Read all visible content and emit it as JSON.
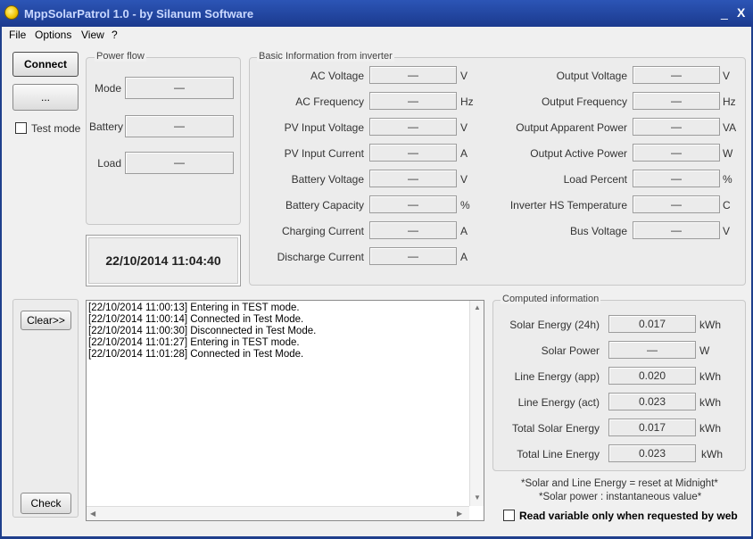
{
  "window": {
    "title": "MppSolarPatrol 1.0 - by Silanum Software",
    "minimize_glyph": "_",
    "close_glyph": "X",
    "app_icon": "sun-icon"
  },
  "menu": [
    {
      "label": "File"
    },
    {
      "label": "Options"
    },
    {
      "label": "View"
    },
    {
      "label": "?"
    }
  ],
  "left": {
    "connect_label": "Connect",
    "port_label": "...",
    "test_mode_label": "Test mode"
  },
  "power_flow": {
    "title": "Power flow",
    "rows": [
      {
        "label": "Mode",
        "value": "—"
      },
      {
        "label": "Battery",
        "value": "—"
      },
      {
        "label": "Load",
        "value": "—"
      }
    ]
  },
  "clock": "22/10/2014 11:04:40",
  "basic_info": {
    "title": "Basic Information from inverter",
    "left": [
      {
        "label": "AC Voltage",
        "value": "—",
        "unit": "V"
      },
      {
        "label": "AC Frequency",
        "value": "—",
        "unit": "Hz"
      },
      {
        "label": "PV Input Voltage",
        "value": "—",
        "unit": "V"
      },
      {
        "label": "PV Input Current",
        "value": "—",
        "unit": "A"
      },
      {
        "label": "Battery Voltage",
        "value": "—",
        "unit": "V"
      },
      {
        "label": "Battery Capacity",
        "value": "—",
        "unit": "%"
      },
      {
        "label": "Charging Current",
        "value": "—",
        "unit": "A"
      },
      {
        "label": "Discharge Current",
        "value": "—",
        "unit": "A"
      }
    ],
    "right": [
      {
        "label": "Output Voltage",
        "value": "—",
        "unit": "V"
      },
      {
        "label": "Output Frequency",
        "value": "—",
        "unit": "Hz"
      },
      {
        "label": "Output Apparent Power",
        "value": "—",
        "unit": "VA"
      },
      {
        "label": "Output Active Power",
        "value": "—",
        "unit": "W"
      },
      {
        "label": "Load Percent",
        "value": "—",
        "unit": "%"
      },
      {
        "label": "Inverter HS Temperature",
        "value": "—",
        "unit": "C"
      },
      {
        "label": "Bus Voltage",
        "value": "—",
        "unit": "V"
      }
    ]
  },
  "log": {
    "clear_label": "Clear>>",
    "check_label": "Check",
    "lines": [
      "[22/10/2014 11:00:13] Entering in TEST mode.",
      "[22/10/2014 11:00:14] Connected in Test Mode.",
      "[22/10/2014 11:00:30] Disconnected in Test Mode.",
      "[22/10/2014 11:01:27] Entering in TEST mode.",
      "[22/10/2014 11:01:28] Connected in Test Mode."
    ]
  },
  "computed": {
    "title": "Computed information",
    "rows": [
      {
        "label": "Solar Energy (24h)",
        "value": "0.017",
        "unit": "kWh"
      },
      {
        "label": "Solar Power",
        "value": "—",
        "unit": "W"
      },
      {
        "label": "Line Energy (app)",
        "value": "0.020",
        "unit": "kWh"
      },
      {
        "label": "Line Energy (act)",
        "value": "0.023",
        "unit": "kWh"
      },
      {
        "label": "Total Solar Energy",
        "value": "0.017",
        "unit": "kWh"
      },
      {
        "label": "Total Line Energy",
        "value": "0.023",
        "unit": "kWh"
      }
    ]
  },
  "notes": {
    "line1": "*Solar and Line  Energy = reset at Midnight*",
    "line2": "*Solar power : instantaneous value*"
  },
  "web_checkbox_label": "Read variable only when requested by web"
}
